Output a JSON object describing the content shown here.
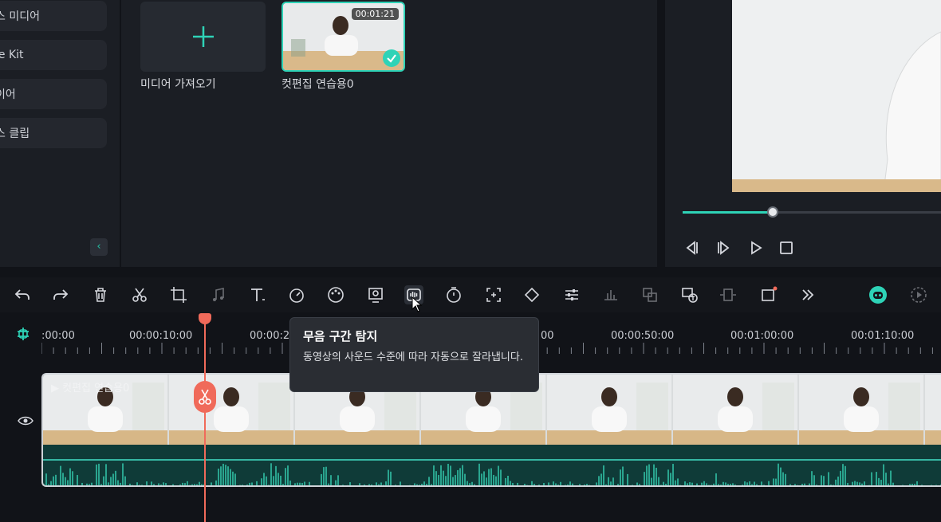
{
  "sidebar": {
    "items": [
      {
        "label": "스 미디어"
      },
      {
        "label": "le Kit"
      },
      {
        "label": "이어"
      },
      {
        "label": "스 클립"
      }
    ],
    "collapse_icon": "chevron-left-icon"
  },
  "media": {
    "import_label": "미디어 가져오기",
    "clip_name": "컷편집 연습용0",
    "clip_duration": "00:01:21"
  },
  "preview": {
    "progress": 0.35
  },
  "toolbar": {
    "icons": [
      "undo-icon",
      "redo-icon",
      "delete-icon",
      "cut-icon",
      "crop-icon",
      "audio-icon",
      "text-icon",
      "speed-icon",
      "color-icon",
      "mask-icon",
      "silence-detect-icon",
      "timer-icon",
      "auto-reframe-icon",
      "keyframe-icon",
      "adjust-icon",
      "audio-stretch-icon",
      "voice-icon",
      "speech-to-text-icon",
      "freeze-icon",
      "more-frame-icon",
      "more-icon",
      "ai-icon",
      "render-icon"
    ]
  },
  "tooltip": {
    "title": "무음 구간 탐지",
    "body": "동영상의 사운드 수준에 따라 자동으로 잘라냅니다."
  },
  "timeline": {
    "timecodes": [
      ":00:00",
      "00:00:10:00",
      "00:00:2",
      "00",
      "00:00:50:00",
      "00:01:00:00",
      "00:01:10:00"
    ],
    "track_title": "컷편집 연습용0"
  },
  "colors": {
    "accent": "#2ed3b7",
    "playhead": "#f06a5a",
    "background": "#111318",
    "panel": "#1b1e24"
  }
}
